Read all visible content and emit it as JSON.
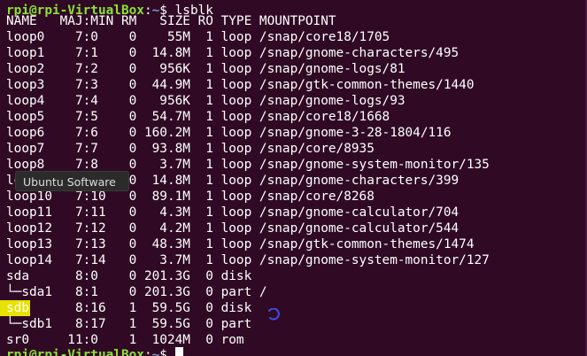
{
  "prompt": {
    "user_host": "rpi@rpi-VirtualBox",
    "separator": ":",
    "path": "~",
    "symbol": "$ ",
    "command": "lsblk"
  },
  "header": "NAME   MAJ:MIN RM   SIZE RO TYPE MOUNTPOINT",
  "rows": [
    "loop0    7:0    0    55M  1 loop /snap/core18/1705",
    "loop1    7:1    0  14.8M  1 loop /snap/gnome-characters/495",
    "loop2    7:2    0   956K  1 loop /snap/gnome-logs/81",
    "loop3    7:3    0  44.9M  1 loop /snap/gtk-common-themes/1440",
    "loop4    7:4    0   956K  1 loop /snap/gnome-logs/93",
    "loop5    7:5    0  54.7M  1 loop /snap/core18/1668",
    "loop6    7:6    0 160.2M  1 loop /snap/gnome-3-28-1804/116",
    "loop7    7:7    0  93.8M  1 loop /snap/core/8935",
    "loop8    7:8    0   3.7M  1 loop /snap/gnome-system-monitor/135",
    "loop9    7:9    0  14.8M  1 loop /snap/gnome-characters/399",
    "loop10   7:10   0  89.1M  1 loop /snap/core/8268",
    "loop11   7:11   0   4.3M  1 loop /snap/gnome-calculator/704",
    "loop12   7:12   0   4.2M  1 loop /snap/gnome-calculator/544",
    "loop13   7:13   0  48.3M  1 loop /snap/gtk-common-themes/1474",
    "loop14   7:14   0   3.7M  1 loop /snap/gnome-system-monitor/127",
    "sda      8:0    0 201.3G  0 disk",
    "└─sda1   8:1    0 201.3G  0 part /",
    "sdb      8:16   1  59.5G  0 disk",
    "└─sdb1   8:17   1  59.5G  0 part",
    "sr0     11:0    1  1024M  0 rom"
  ],
  "final_prompt": {
    "user_host": "rpi@rpi-VirtualBox",
    "separator": ":",
    "path": "~",
    "symbol": "$ "
  },
  "tooltip": {
    "text": "Ubuntu Software"
  },
  "colors": {
    "background": "#300a24",
    "prompt_user": "#8ae234",
    "prompt_path": "#729fcf",
    "highlight": "#e8e200"
  }
}
